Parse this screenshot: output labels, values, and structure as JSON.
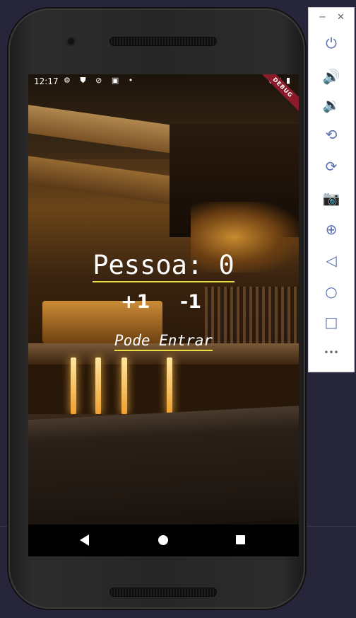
{
  "status_bar": {
    "time": "12:17",
    "left_icons": "⚙ ⛊ ⊘ ▣ •",
    "right_icons": "▼◢ ▮",
    "debug_banner": "DEBUG"
  },
  "app": {
    "counter_label": "Pessoa: 0",
    "increment_label": "+1",
    "decrement_label": "-1",
    "status_message": "Pode Entrar",
    "accent_underline": "#e8e040"
  },
  "nav_bar": {
    "back": "back-icon",
    "home": "home-icon",
    "recents": "recents-icon"
  },
  "emulator_panel": {
    "minimize": "−",
    "close": "✕",
    "tools": [
      {
        "name": "power-icon",
        "glyph": "⏻"
      },
      {
        "name": "volume-up-icon",
        "glyph": "🔊"
      },
      {
        "name": "volume-down-icon",
        "glyph": "🔉"
      },
      {
        "name": "rotate-left-icon",
        "glyph": "⟲"
      },
      {
        "name": "rotate-right-icon",
        "glyph": "⟳"
      },
      {
        "name": "camera-icon",
        "glyph": "📷"
      },
      {
        "name": "zoom-icon",
        "glyph": "⊕"
      },
      {
        "name": "back-icon",
        "glyph": "◁"
      },
      {
        "name": "home-icon",
        "glyph": "○"
      },
      {
        "name": "overview-icon",
        "glyph": "□"
      },
      {
        "name": "more-icon",
        "glyph": "•••"
      }
    ]
  }
}
